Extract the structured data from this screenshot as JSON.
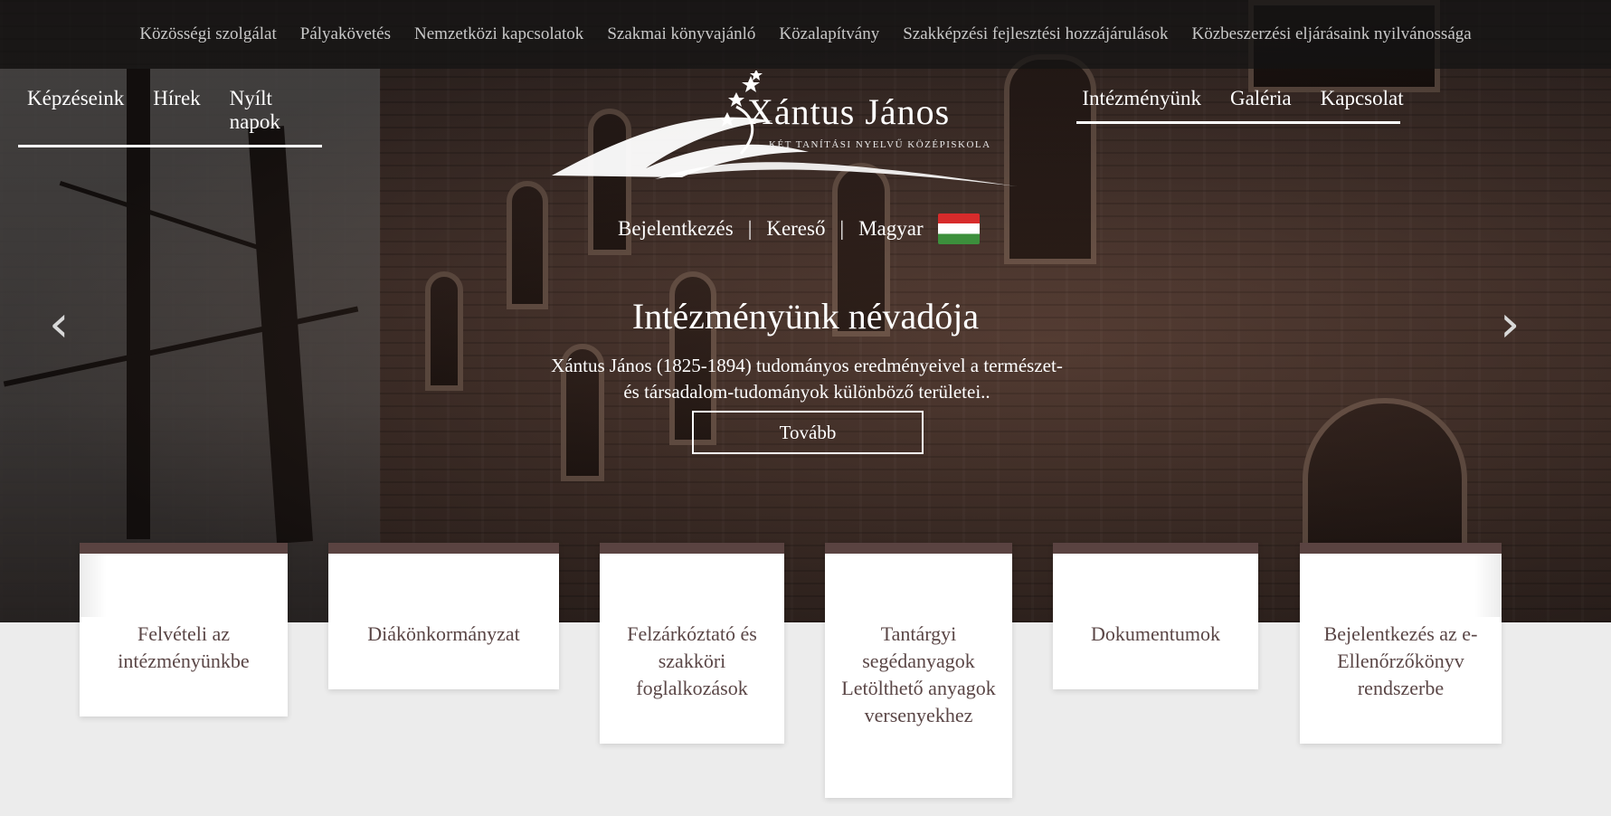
{
  "topbar": {
    "links": [
      "Közösségi szolgálat",
      "Pályakövetés",
      "Nemzetközi kapcsolatok",
      "Szakmai könyvajánló",
      "Közalapítvány",
      "Szakképzési fejlesztési hozzájárulások",
      "Közbeszerzési eljárásaink nyilvánossága"
    ]
  },
  "nav": {
    "left": [
      "Képzéseink",
      "Hírek",
      "Nyílt napok"
    ],
    "right": [
      "Intézményünk",
      "Galéria",
      "Kapcsolat"
    ]
  },
  "logo": {
    "name": "Xántus János",
    "subtitle": "Két tanítási nyelvű középiskola"
  },
  "utility": {
    "login": "Bejelentkezés",
    "separator": "|",
    "search": "Kereső",
    "language": "Magyar",
    "flag_icon": "hungarian-flag-icon"
  },
  "carousel": {
    "title": "Intézményünk névadója",
    "text": "Xántus János (1825-1894) tudományos eredményeivel a természet- és társadalom-tudományok különböző területei..",
    "button": "Tovább",
    "prev_icon": "‹",
    "next_icon": "›"
  },
  "cards": [
    "Felvételi az intézményünkbe",
    "Diákönkormányzat",
    "Felzárkóztató és szakköri foglalkozások",
    "Tantárgyi segédanyagok Letölthető anyagok versenyekhez",
    "Dokumentumok",
    "Bejelentkezés az e-Ellenőrzőkönyv rendszerbe"
  ],
  "colors": {
    "card_border": "#5a4341",
    "card_text": "#5a4646",
    "topbar_text": "#c9c9c9"
  }
}
